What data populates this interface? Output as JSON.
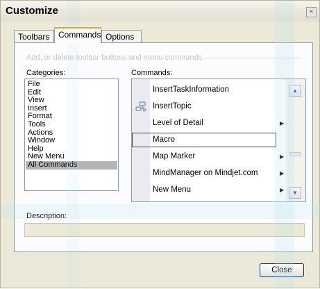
{
  "window": {
    "title": "Customize",
    "close_glyph": "×"
  },
  "tabs": [
    {
      "label": "Toolbars"
    },
    {
      "label": "Commands"
    },
    {
      "label": "Options"
    }
  ],
  "group_caption": "Add, or delete toolbar buttons and menu commands",
  "categories": {
    "label": "Categories:",
    "items": [
      "File",
      "Edit",
      "View",
      "Insert",
      "Format",
      "Tools",
      "Actions",
      "Window",
      "Help",
      "New Menu",
      "All Commands"
    ],
    "selected": "All Commands"
  },
  "commands": {
    "label": "Commands:",
    "items": [
      {
        "label": "InsertTaskInformation",
        "has_submenu": false,
        "icon": ""
      },
      {
        "label": "InsertTopic",
        "has_submenu": false,
        "icon": "insert-topic-icon"
      },
      {
        "label": "Level of Detail",
        "has_submenu": true,
        "icon": ""
      },
      {
        "label": "Macro",
        "has_submenu": false,
        "icon": ""
      },
      {
        "label": "Map Marker",
        "has_submenu": true,
        "icon": ""
      },
      {
        "label": "MindManager on Mindjet.com",
        "has_submenu": true,
        "icon": ""
      },
      {
        "label": "New Menu",
        "has_submenu": true,
        "icon": ""
      }
    ],
    "selected": "Macro"
  },
  "description": {
    "label": "Description:",
    "value": ""
  },
  "buttons": {
    "close_label": "Close"
  },
  "colors": {
    "dialog_bg": "#ece9d8",
    "active_tab_accent": "#e6a538",
    "selection_bg": "#b4b4b4"
  }
}
